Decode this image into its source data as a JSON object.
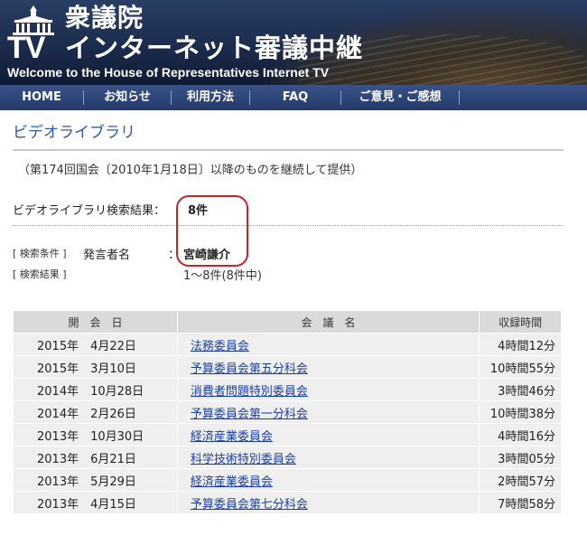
{
  "header": {
    "title_top": "衆議院",
    "tv_mark": "TV",
    "title_main": "インターネット審議中継",
    "title_en": "Welcome to the House of Representatives Internet TV"
  },
  "nav": {
    "items": [
      {
        "label": "HOME"
      },
      {
        "label": "お知らせ"
      },
      {
        "label": "利用方法"
      },
      {
        "label": "FAQ"
      },
      {
        "label": "ご意見・ご感想"
      }
    ]
  },
  "page": {
    "title": "ビデオライブラリ",
    "notice": "（第174回国会〔2010年1月18日〕以降のものを継続して提供）",
    "result_label": "ビデオライブラリ検索結果：",
    "result_count": "8件",
    "condition_tag": "[ 検索条件 ]",
    "condition_label": "発言者名",
    "condition_colon": "：",
    "condition_value": "宮崎謙介",
    "result_tag": "[ 検索結果 ]",
    "result_range": "1～8件(8件中)"
  },
  "table": {
    "headers": {
      "date": "開　会　日",
      "meeting": "会　議　名",
      "duration": "収録時間"
    },
    "rows": [
      {
        "date": "2015年　4月22日",
        "meeting": "法務委員会",
        "duration": "4時間12分"
      },
      {
        "date": "2015年　3月10日",
        "meeting": "予算委員会第五分科会",
        "duration": "10時間55分"
      },
      {
        "date": "2014年　10月28日",
        "meeting": "消費者問題特別委員会",
        "duration": "3時間46分"
      },
      {
        "date": "2014年　2月26日",
        "meeting": "予算委員会第一分科会",
        "duration": "10時間38分"
      },
      {
        "date": "2013年　10月30日",
        "meeting": "経済産業委員会",
        "duration": "4時間16分"
      },
      {
        "date": "2013年　6月21日",
        "meeting": "科学技術特別委員会",
        "duration": "3時間05分"
      },
      {
        "date": "2013年　5月29日",
        "meeting": "経済産業委員会",
        "duration": "2時間57分"
      },
      {
        "date": "2013年　4月15日",
        "meeting": "予算委員会第七分科会",
        "duration": "7時間58分"
      }
    ]
  },
  "colors": {
    "nav_bg": "#243a6a",
    "title_blue": "#2a5aa8",
    "link_blue": "#1a3fa8",
    "highlight_red": "#c9222a"
  }
}
